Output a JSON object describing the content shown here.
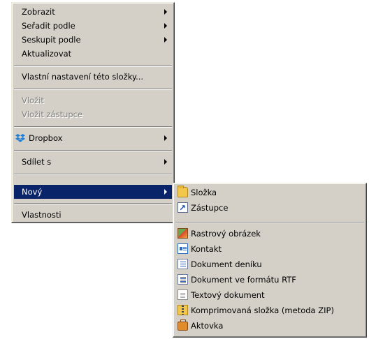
{
  "context_menu": {
    "items": [
      {
        "label": "Zobrazit",
        "submenu": true
      },
      {
        "label": "Seřadit podle",
        "submenu": true
      },
      {
        "label": "Seskupit podle",
        "submenu": true
      },
      {
        "label": "Aktualizovat"
      },
      {
        "label": "Vlastní nastavení této složky..."
      },
      {
        "label": "Vložit",
        "disabled": true
      },
      {
        "label": "Vložit zástupce",
        "disabled": true
      },
      {
        "label": "Dropbox",
        "submenu": true,
        "icon": "dropbox-icon"
      },
      {
        "label": "Sdílet s",
        "submenu": true
      },
      {
        "label": "Nový",
        "submenu": true,
        "selected": true
      },
      {
        "label": "Vlastnosti"
      }
    ]
  },
  "new_submenu": {
    "items": [
      {
        "label": "Složka",
        "icon": "folder-icon"
      },
      {
        "label": "Zástupce",
        "icon": "shortcut-icon"
      },
      {
        "label": "Rastrový obrázek",
        "icon": "bitmap-image-icon"
      },
      {
        "label": "Kontakt",
        "icon": "contact-icon"
      },
      {
        "label": "Dokument deníku",
        "icon": "journal-document-icon"
      },
      {
        "label": "Dokument ve formátu RTF",
        "icon": "rtf-document-icon"
      },
      {
        "label": "Textový dokument",
        "icon": "text-document-icon"
      },
      {
        "label": "Komprimovaná složka (metoda ZIP)",
        "icon": "zip-folder-icon"
      },
      {
        "label": "Aktovka",
        "icon": "briefcase-icon"
      }
    ]
  },
  "colors": {
    "menu_background": "#d4d0c8",
    "selection_background": "#0a246a",
    "disabled_text": "#808080"
  }
}
